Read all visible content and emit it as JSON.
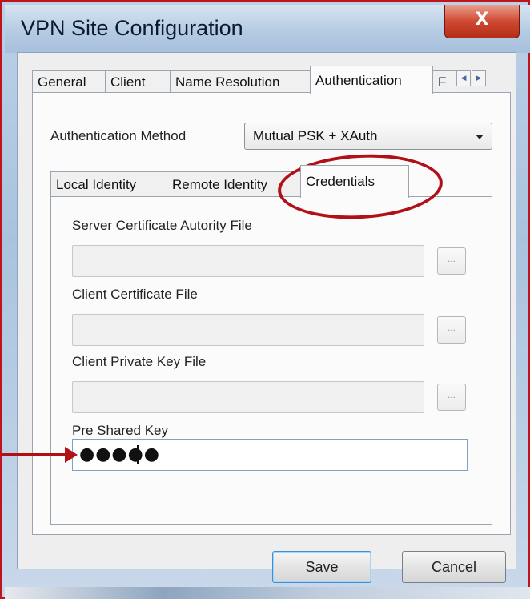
{
  "window": {
    "title": "VPN Site Configuration",
    "close_glyph": "X"
  },
  "main_tabs": [
    {
      "label": "General"
    },
    {
      "label": "Client"
    },
    {
      "label": "Name Resolution"
    },
    {
      "label": "Authentication"
    },
    {
      "label": "F"
    }
  ],
  "tab_scroll": {
    "left_glyph": "◀",
    "right_glyph": "▶"
  },
  "auth": {
    "method_label": "Authentication Method",
    "method_value": "Mutual PSK + XAuth"
  },
  "sub_tabs": [
    {
      "label": "Local Identity"
    },
    {
      "label": "Remote Identity"
    },
    {
      "label": "Credentials"
    }
  ],
  "credentials": {
    "server_ca_label": "Server Certificate Autority File",
    "server_ca_value": "",
    "client_cert_label": "Client Certificate File",
    "client_cert_value": "",
    "client_key_label": "Client Private Key File",
    "client_key_value": "",
    "browse_glyph": "...",
    "psk_label": "Pre Shared Key",
    "psk_masked": "●●●●●"
  },
  "buttons": {
    "save": "Save",
    "cancel": "Cancel"
  },
  "colors": {
    "annotation_red": "#b01016",
    "close_button": "#cf4a32"
  }
}
